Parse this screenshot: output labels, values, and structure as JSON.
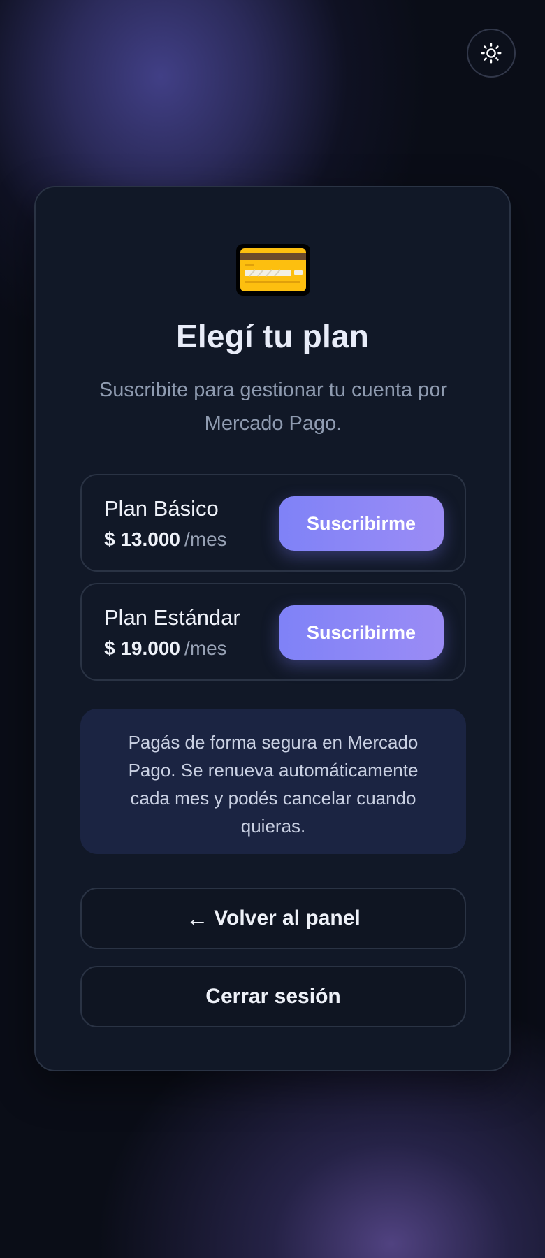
{
  "header": {
    "theme_toggle_icon": "sun-icon"
  },
  "main": {
    "icon": "credit-card-icon",
    "title": "Elegí tu plan",
    "subtitle": "Suscribite para gestionar tu cuenta por Mercado Pago.",
    "plans": [
      {
        "name": "Plan Básico",
        "price": "$ 13.000",
        "period": "/mes",
        "button_label": "Suscribirme"
      },
      {
        "name": "Plan Estándar",
        "price": "$ 19.000",
        "period": "/mes",
        "button_label": "Suscribirme"
      }
    ],
    "info_text": "Pagás de forma segura en Mercado Pago. Se renueva automáticamente cada mes y podés cancelar cuando quieras.",
    "back_button": {
      "arrow": "←",
      "label": "Volver al panel"
    },
    "logout_button": {
      "label": "Cerrar sesión"
    }
  },
  "colors": {
    "accent_start": "#7f82f7",
    "accent_end": "#9b8cf5",
    "card_background": "#111827",
    "info_background": "#1b2442"
  }
}
